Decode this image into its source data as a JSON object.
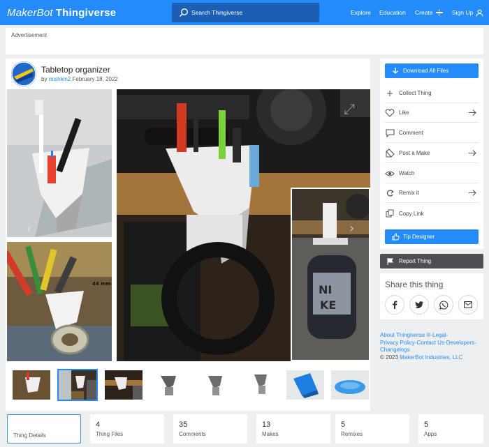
{
  "header": {
    "logo_maker": "MakerBot",
    "logo_thing": "Thingiverse",
    "search_placeholder": "Search Thingiverse",
    "nav": {
      "explore": "Explore",
      "education": "Education",
      "create": "Create",
      "signup": "Sign Up"
    },
    "bar_color": "#248bfb"
  },
  "ad": {
    "label": "Advertisement"
  },
  "thing": {
    "title": "Tabletop organizer",
    "by": "by",
    "author": "mishkin2",
    "date": "February 18, 2022"
  },
  "sidebar": {
    "download": "Download All Files",
    "actions": [
      {
        "label": "Collect Thing",
        "icon": "plus-icon",
        "arrow": false
      },
      {
        "label": "Like",
        "icon": "heart-icon",
        "arrow": true
      },
      {
        "label": "Comment",
        "icon": "comment-icon",
        "arrow": false
      },
      {
        "label": "Post a Make",
        "icon": "make-icon",
        "arrow": true
      },
      {
        "label": "Watch",
        "icon": "eye-icon",
        "arrow": false
      },
      {
        "label": "Remix it",
        "icon": "remix-icon",
        "arrow": true
      },
      {
        "label": "Copy Link",
        "icon": "link-icon",
        "arrow": false
      }
    ],
    "tip": "Tip Designer",
    "report": "Report Thing",
    "share_title": "Share this thing",
    "share": [
      "facebook-icon",
      "twitter-icon",
      "whatsapp-icon",
      "email-icon"
    ]
  },
  "footer": {
    "line1": "About Thingiverse ®-Legal-",
    "line2": "Privacy Policy-Contact Us-Developers-",
    "line3": "Changelogs",
    "copy_prefix": "©  2023 ",
    "copy_link": "MakerBot Industries, LLC"
  },
  "tabs": [
    {
      "num": "",
      "label": "Thing Details"
    },
    {
      "num": "4",
      "label": "Thing Files"
    },
    {
      "num": "35",
      "label": "Comments"
    },
    {
      "num": "13",
      "label": "Makes"
    },
    {
      "num": "5",
      "label": "Remixes"
    },
    {
      "num": "5",
      "label": "Apps"
    }
  ],
  "thumbnails_count": 8,
  "selected_thumbnail": 2
}
